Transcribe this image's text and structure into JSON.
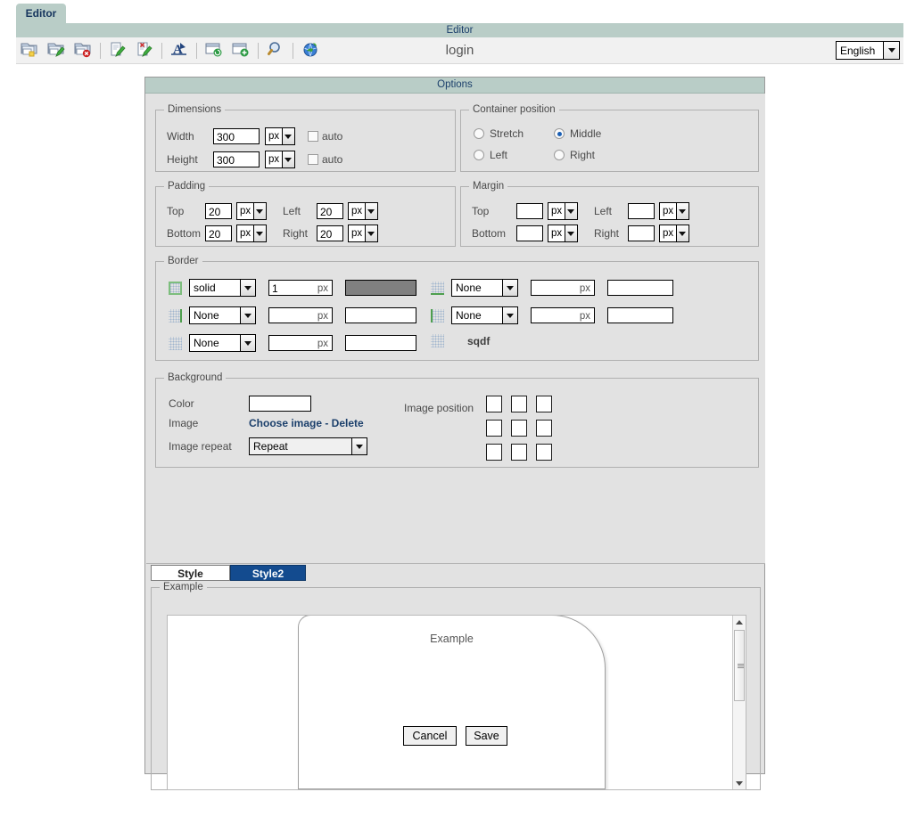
{
  "window": {
    "app_tab_label": "Editor",
    "title_band": "Editor"
  },
  "toolbar": {
    "document_title": "login",
    "language_value": "English",
    "icons": [
      {
        "name": "new-folder-icon",
        "glyph": "new-folder"
      },
      {
        "name": "edit-folder-icon",
        "glyph": "edit-folder"
      },
      {
        "name": "delete-folder-icon",
        "glyph": "delete-folder"
      },
      {
        "name": "edit-page-icon",
        "glyph": "edit-page"
      },
      {
        "name": "delete-page-icon",
        "glyph": "delete-page"
      },
      {
        "name": "font-style-icon",
        "glyph": "font-style"
      },
      {
        "name": "refresh-window-icon",
        "glyph": "refresh-window"
      },
      {
        "name": "add-window-icon",
        "glyph": "add-window"
      },
      {
        "name": "preview-search-icon",
        "glyph": "magnifier"
      },
      {
        "name": "publish-globe-icon",
        "glyph": "globe"
      }
    ]
  },
  "panel": {
    "header": "Options"
  },
  "dimensions": {
    "legend": "Dimensions",
    "width_label": "Width",
    "width_value": "300",
    "width_unit": "px",
    "width_auto_label": "auto",
    "width_auto_checked": false,
    "height_label": "Height",
    "height_value": "300",
    "height_unit": "px",
    "height_auto_label": "auto",
    "height_auto_checked": false
  },
  "container_position": {
    "legend": "Container position",
    "options": [
      {
        "label": "Stretch",
        "selected": false
      },
      {
        "label": "Middle",
        "selected": true
      },
      {
        "label": "Left",
        "selected": false
      },
      {
        "label": "Right",
        "selected": false
      }
    ]
  },
  "padding": {
    "legend": "Padding",
    "top_label": "Top",
    "top_value": "20",
    "top_unit": "px",
    "bottom_label": "Bottom",
    "bottom_value": "20",
    "bottom_unit": "px",
    "left_label": "Left",
    "left_value": "20",
    "left_unit": "px",
    "right_label": "Right",
    "right_value": "20",
    "right_unit": "px"
  },
  "margin": {
    "legend": "Margin",
    "top_label": "Top",
    "top_value": "",
    "top_unit": "px",
    "bottom_label": "Bottom",
    "bottom_value": "",
    "bottom_unit": "px",
    "left_label": "Left",
    "left_value": "",
    "left_unit": "px",
    "right_label": "Right",
    "right_value": "",
    "right_unit": "px"
  },
  "border": {
    "legend": "Border",
    "unit_label": "px",
    "rows": [
      {
        "icon": "border-all-icon",
        "style": "solid",
        "width_value": "1",
        "width_unit": "px",
        "color": "#808080"
      },
      {
        "icon": "border-bottom-icon",
        "style": "None",
        "width_value": "",
        "width_unit": "px",
        "color": "#ffffff"
      },
      {
        "icon": "border-right-icon",
        "style": "None",
        "width_value": "",
        "width_unit": "px",
        "color": "#ffffff"
      },
      {
        "icon": "border-top-icon",
        "style": "None",
        "width_value": "",
        "width_unit": "px",
        "color": "#ffffff"
      },
      {
        "icon": "border-left-icon",
        "style": "None",
        "width_value": "",
        "width_unit": "px",
        "color": "#ffffff"
      }
    ],
    "extra_icon": "border-radius-icon",
    "extra_label": "sqdf"
  },
  "background": {
    "legend": "Background",
    "color_label": "Color",
    "color_value": "#ffffff",
    "image_label": "Image",
    "image_actions": "Choose image - Delete",
    "image_repeat_label": "Image repeat",
    "image_repeat_value": "Repeat",
    "image_position_label": "Image position",
    "position_cells": [
      "top-left",
      "top-center",
      "top-right",
      "middle-left",
      "middle-center",
      "middle-right",
      "bottom-left",
      "bottom-center",
      "bottom-right"
    ]
  },
  "style_tabs": [
    {
      "label": "Style",
      "active": false
    },
    {
      "label": "Style2",
      "active": true
    }
  ],
  "example": {
    "legend": "Example",
    "preview_text": "Example"
  },
  "footer": {
    "cancel_label": "Cancel",
    "save_label": "Save"
  },
  "colors": {
    "accent_header": "#b9cdc7",
    "header_text": "#1b3f6b",
    "panel_bg": "#e2e2e2",
    "active_tab": "#134b8f",
    "border_swatch": "#808080"
  }
}
